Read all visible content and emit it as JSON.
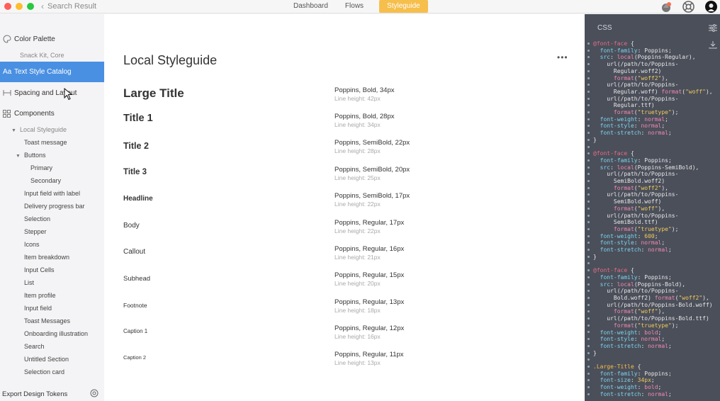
{
  "window": {
    "back_label": "Search Result",
    "tabs": [
      {
        "label": "Dashboard",
        "active": false
      },
      {
        "label": "Flows",
        "active": false
      },
      {
        "label": "Styleguide",
        "active": true
      }
    ],
    "accent": "#f6be4b",
    "traffic_lights": [
      "#fe5f57",
      "#febc2e",
      "#28c840"
    ]
  },
  "sidebar": {
    "items": [
      {
        "label": "Color Palette",
        "icon": "palette-icon"
      },
      {
        "label": "Snack Kit, Core",
        "sub": true
      },
      {
        "label": "Text Style Catalog",
        "icon": "text-style-icon",
        "active": true
      },
      {
        "label": "Spacing and Layout",
        "icon": "spacing-icon"
      },
      {
        "label": "Components",
        "icon": "components-icon"
      }
    ],
    "tree": [
      {
        "label": "Local Styleguide",
        "level": 1,
        "expanded": true
      },
      {
        "label": "Toast message",
        "level": 2
      },
      {
        "label": "Buttons",
        "level": 2,
        "expanded": true
      },
      {
        "label": "Primary",
        "level": 3
      },
      {
        "label": "Secondary",
        "level": 3
      },
      {
        "label": "Input field with label",
        "level": 2
      },
      {
        "label": "Delivery progress bar",
        "level": 2
      },
      {
        "label": "Selection",
        "level": 2
      },
      {
        "label": "Stepper",
        "level": 2
      },
      {
        "label": "Icons",
        "level": 2
      },
      {
        "label": "Item breakdown",
        "level": 2
      },
      {
        "label": "Input Cells",
        "level": 2
      },
      {
        "label": "List",
        "level": 2
      },
      {
        "label": "Item profile",
        "level": 2
      },
      {
        "label": "Input field",
        "level": 2
      },
      {
        "label": "Toast Messages",
        "level": 2
      },
      {
        "label": "Onboarding illustration",
        "level": 2
      },
      {
        "label": "Search",
        "level": 2
      },
      {
        "label": "Untitled Section",
        "level": 2
      },
      {
        "label": "Selection card",
        "level": 2
      }
    ],
    "export_label": "Export Design Tokens",
    "active_color": "#4a90e2"
  },
  "main": {
    "title": "Local Styleguide",
    "more_label": "•••",
    "styles": [
      {
        "name": "Large Title",
        "spec": "Poppins, Bold, 34px",
        "line_height": "Line height: 42px",
        "size": 17,
        "weight": "bold"
      },
      {
        "name": "Title 1",
        "spec": "Poppins, Bold, 28px",
        "line_height": "Line height: 34px",
        "size": 14.5,
        "weight": "bold"
      },
      {
        "name": "Title 2",
        "spec": "Poppins, SemiBold, 22px",
        "line_height": "Line height: 28px",
        "size": 12.5,
        "weight": "bold"
      },
      {
        "name": "Title 3",
        "spec": "Poppins, SemiBold, 20px",
        "line_height": "Line height: 25px",
        "size": 11.5,
        "weight": "bold"
      },
      {
        "name": "Headline",
        "spec": "Poppins, SemiBold, 17px",
        "line_height": "Line height: 22px",
        "size": 10,
        "weight": "bold"
      },
      {
        "name": "Body",
        "spec": "Poppins, Regular, 17px",
        "line_height": "Line height: 22px",
        "size": 10,
        "weight": "normal"
      },
      {
        "name": "Callout",
        "spec": "Poppins, Regular, 16px",
        "line_height": "Line height: 21px",
        "size": 10,
        "weight": "normal"
      },
      {
        "name": "Subhead",
        "spec": "Poppins, Regular, 15px",
        "line_height": "Line height: 20px",
        "size": 9.5,
        "weight": "normal"
      },
      {
        "name": "Footnote",
        "spec": "Poppins, Regular, 13px",
        "line_height": "Line height: 18px",
        "size": 8.5,
        "weight": "normal"
      },
      {
        "name": "Caption 1",
        "spec": "Poppins, Regular, 12px",
        "line_height": "Line height: 16px",
        "size": 8,
        "weight": "normal"
      },
      {
        "name": "Caption 2",
        "spec": "Poppins, Regular, 11px",
        "line_height": "Line height: 13px",
        "size": 7.5,
        "weight": "normal"
      }
    ]
  },
  "css_panel": {
    "title": "CSS",
    "lines": [
      [
        [
          "at",
          "@font-face"
        ],
        [
          "p",
          " {"
        ]
      ],
      [
        [
          "prop",
          "  font-family"
        ],
        [
          "p",
          ": Poppins;"
        ]
      ],
      [
        [
          "prop",
          "  src"
        ],
        [
          "p",
          ": "
        ],
        [
          "kw",
          "local"
        ],
        [
          "p",
          "(Poppins-Regular),"
        ]
      ],
      [
        [
          "p",
          "    url(/path/to/Poppins-"
        ]
      ],
      [
        [
          "p",
          "      Regular.woff2)"
        ]
      ],
      [
        [
          "kw",
          "      format"
        ],
        [
          "p",
          "("
        ],
        [
          "str",
          "\"woff2\""
        ],
        [
          "p",
          "),"
        ]
      ],
      [
        [
          "p",
          "    url(/path/to/Poppins-"
        ]
      ],
      [
        [
          "p",
          "      Regular.woff) "
        ],
        [
          "kw",
          "format"
        ],
        [
          "p",
          "("
        ],
        [
          "str",
          "\"woff\""
        ],
        [
          "p",
          "),"
        ]
      ],
      [
        [
          "p",
          "    url(/path/to/Poppins-"
        ]
      ],
      [
        [
          "p",
          "      Regular.ttf)"
        ]
      ],
      [
        [
          "kw",
          "      format"
        ],
        [
          "p",
          "("
        ],
        [
          "str",
          "\"truetype\""
        ],
        [
          "p",
          ");"
        ]
      ],
      [
        [
          "prop",
          "  font-weight"
        ],
        [
          "p",
          ": "
        ],
        [
          "kw",
          "normal"
        ],
        [
          "p",
          ";"
        ]
      ],
      [
        [
          "prop",
          "  font-style"
        ],
        [
          "p",
          ": "
        ],
        [
          "kw",
          "normal"
        ],
        [
          "p",
          ";"
        ]
      ],
      [
        [
          "prop",
          "  font-stretch"
        ],
        [
          "p",
          ": "
        ],
        [
          "kw",
          "normal"
        ],
        [
          "p",
          ";"
        ]
      ],
      [
        [
          "p",
          "}"
        ]
      ],
      [
        [
          "p",
          ""
        ]
      ],
      [
        [
          "at",
          "@font-face"
        ],
        [
          "p",
          " {"
        ]
      ],
      [
        [
          "prop",
          "  font-family"
        ],
        [
          "p",
          ": Poppins;"
        ]
      ],
      [
        [
          "prop",
          "  src"
        ],
        [
          "p",
          ": "
        ],
        [
          "kw",
          "local"
        ],
        [
          "p",
          "(Poppins-SemiBold),"
        ]
      ],
      [
        [
          "p",
          "    url(/path/to/Poppins-"
        ]
      ],
      [
        [
          "p",
          "      SemiBold.woff2)"
        ]
      ],
      [
        [
          "kw",
          "      format"
        ],
        [
          "p",
          "("
        ],
        [
          "str",
          "\"woff2\""
        ],
        [
          "p",
          "),"
        ]
      ],
      [
        [
          "p",
          "    url(/path/to/Poppins-"
        ]
      ],
      [
        [
          "p",
          "      SemiBold.woff)"
        ]
      ],
      [
        [
          "kw",
          "      format"
        ],
        [
          "p",
          "("
        ],
        [
          "str",
          "\"woff\""
        ],
        [
          "p",
          "),"
        ]
      ],
      [
        [
          "p",
          "    url(/path/to/Poppins-"
        ]
      ],
      [
        [
          "p",
          "      SemiBold.ttf)"
        ]
      ],
      [
        [
          "kw",
          "      format"
        ],
        [
          "p",
          "("
        ],
        [
          "str",
          "\"truetype\""
        ],
        [
          "p",
          ");"
        ]
      ],
      [
        [
          "prop",
          "  font-weight"
        ],
        [
          "p",
          ": "
        ],
        [
          "num",
          "600"
        ],
        [
          "p",
          ";"
        ]
      ],
      [
        [
          "prop",
          "  font-style"
        ],
        [
          "p",
          ": "
        ],
        [
          "kw",
          "normal"
        ],
        [
          "p",
          ";"
        ]
      ],
      [
        [
          "prop",
          "  font-stretch"
        ],
        [
          "p",
          ": "
        ],
        [
          "kw",
          "normal"
        ],
        [
          "p",
          ";"
        ]
      ],
      [
        [
          "p",
          "}"
        ]
      ],
      [
        [
          "p",
          ""
        ]
      ],
      [
        [
          "at",
          "@font-face"
        ],
        [
          "p",
          " {"
        ]
      ],
      [
        [
          "prop",
          "  font-family"
        ],
        [
          "p",
          ": Poppins;"
        ]
      ],
      [
        [
          "prop",
          "  src"
        ],
        [
          "p",
          ": "
        ],
        [
          "kw",
          "local"
        ],
        [
          "p",
          "(Poppins-Bold),"
        ]
      ],
      [
        [
          "p",
          "    url(/path/to/Poppins-"
        ]
      ],
      [
        [
          "p",
          "      Bold.woff2) "
        ],
        [
          "kw",
          "format"
        ],
        [
          "p",
          "("
        ],
        [
          "str",
          "\"woff2\""
        ],
        [
          "p",
          "),"
        ]
      ],
      [
        [
          "p",
          "    url(/path/to/Poppins-Bold.woff)"
        ]
      ],
      [
        [
          "kw",
          "      format"
        ],
        [
          "p",
          "("
        ],
        [
          "str",
          "\"woff\""
        ],
        [
          "p",
          "),"
        ]
      ],
      [
        [
          "p",
          "    url(/path/to/Poppins-Bold.ttf)"
        ]
      ],
      [
        [
          "kw",
          "      format"
        ],
        [
          "p",
          "("
        ],
        [
          "str",
          "\"truetype\""
        ],
        [
          "p",
          ");"
        ]
      ],
      [
        [
          "prop",
          "  font-weight"
        ],
        [
          "p",
          ": "
        ],
        [
          "kw",
          "bold"
        ],
        [
          "p",
          ";"
        ]
      ],
      [
        [
          "prop",
          "  font-style"
        ],
        [
          "p",
          ": "
        ],
        [
          "kw",
          "normal"
        ],
        [
          "p",
          ";"
        ]
      ],
      [
        [
          "prop",
          "  font-stretch"
        ],
        [
          "p",
          ": "
        ],
        [
          "kw",
          "normal"
        ],
        [
          "p",
          ";"
        ]
      ],
      [
        [
          "p",
          "}"
        ]
      ],
      [
        [
          "p",
          ""
        ]
      ],
      [
        [
          "sel",
          ".Large-Title"
        ],
        [
          "p",
          " {"
        ]
      ],
      [
        [
          "prop",
          "  font-family"
        ],
        [
          "p",
          ": Poppins;"
        ]
      ],
      [
        [
          "prop",
          "  font-size"
        ],
        [
          "p",
          ": "
        ],
        [
          "num",
          "34px"
        ],
        [
          "p",
          ";"
        ]
      ],
      [
        [
          "prop",
          "  font-weight"
        ],
        [
          "p",
          ": "
        ],
        [
          "kw",
          "bold"
        ],
        [
          "p",
          ";"
        ]
      ],
      [
        [
          "prop",
          "  font-stretch"
        ],
        [
          "p",
          ": "
        ],
        [
          "kw",
          "normal"
        ],
        [
          "p",
          ";"
        ]
      ]
    ]
  }
}
